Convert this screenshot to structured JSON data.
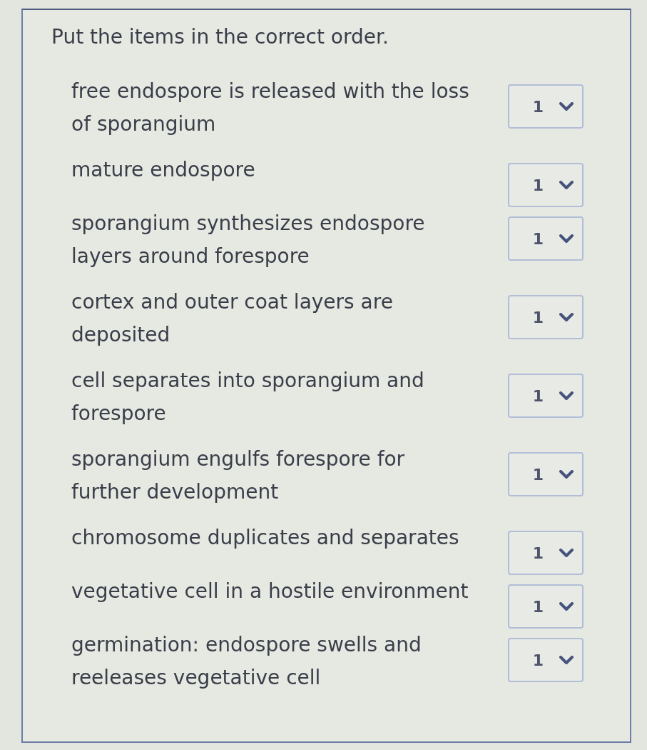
{
  "prompt": "Put the items in the correct order.",
  "items": [
    {
      "text": "free endospore is released with the loss of sporangium",
      "order": "1"
    },
    {
      "text": "mature endospore",
      "order": "1"
    },
    {
      "text": "sporangium synthesizes endospore layers around forespore",
      "order": "1"
    },
    {
      "text": "cortex and outer coat layers are deposited",
      "order": "1"
    },
    {
      "text": "cell separates into sporangium and forespore",
      "order": "1"
    },
    {
      "text": "sporangium engulfs forespore for further development",
      "order": "1"
    },
    {
      "text": "chromosome duplicates and separates",
      "order": "1"
    },
    {
      "text": "vegetative cell in a hostile environment",
      "order": "1"
    },
    {
      "text": "germination: endospore swells and reeleases vegetative cell",
      "order": "1"
    }
  ]
}
